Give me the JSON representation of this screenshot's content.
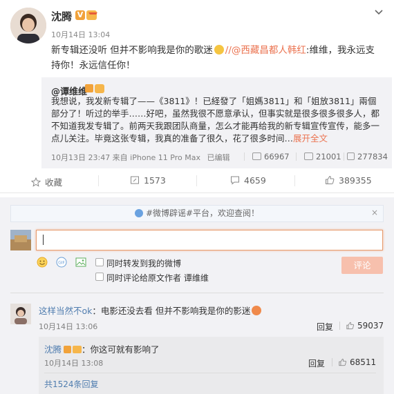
{
  "post": {
    "author": "沈腾",
    "v_badge": "V",
    "time": "10月14日 13:04",
    "text_before": "新专辑还没听 但并不影响我是你的歌迷",
    "text_link": "//@西藏昌都人韩红",
    "text_after": ":维维，我永远支持你！永远信任你！"
  },
  "repost": {
    "author": "@谭维维",
    "text": "我想说，我发新专辑了——《3811》！已経發了「姐媽3811」和「姐放3811」兩個部分了！听过的举手……好吧，虽然我很不愿意承认，但事实就是很多很多很多人，都不知道我发专辑了。前两天我跟团队商量，怎么才能再给我的新专辑宣传宣传，能多一点儿关注。毕竟这张专辑，我真的准备了很久，花了很多时间…",
    "more": "展开全文",
    "meta": "10月13日 23:47 来自 iPhone 11 Pro Max",
    "edited": "已编辑",
    "reposts": "66967",
    "comments": "21001",
    "likes": "277834"
  },
  "actions": {
    "favorite": "收藏",
    "repost": "1573",
    "comment": "4659",
    "like": "389355"
  },
  "comment_panel": {
    "notice_text": "#微博辟谣#平台，欢迎查阅！",
    "notice_close": "×",
    "input_value": "",
    "check_repost": "同时转发到我的微博",
    "check_orig_label": "同时评论给原文作者",
    "check_orig_name": "谭维维",
    "submit": "评论"
  },
  "comments": [
    {
      "user": "这样当然不ok",
      "text": "：电影还没去看 但并不影响我是你的影迷",
      "time": "10月14日 13:06",
      "reply": "回复",
      "likes": "59037"
    }
  ],
  "nested_reply": {
    "user": "沈腾",
    "text": "：你这可就有影响了",
    "time": "10月14日 13:08",
    "reply": "回复",
    "likes": "68511",
    "more": "共1524条回复"
  },
  "colors": {
    "accent": "#eb7350",
    "link_blue": "#507daf",
    "panel_bg": "#f2f2f5"
  }
}
